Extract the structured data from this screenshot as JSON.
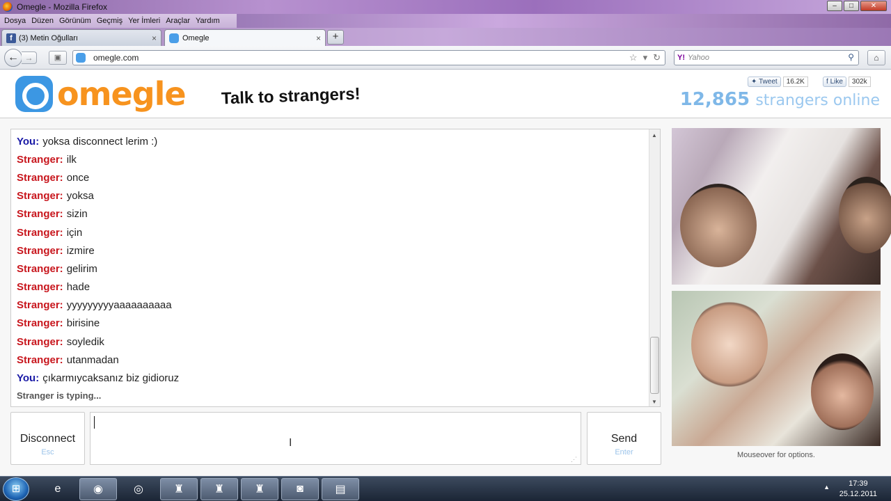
{
  "window": {
    "title": "Omegle - Mozilla Firefox",
    "controls": [
      "–",
      "□",
      "✕"
    ]
  },
  "menu": [
    "Dosya",
    "Düzen",
    "Görünüm",
    "Geçmiş",
    "Yer İmleri",
    "Araçlar",
    "Yardım"
  ],
  "tabs": [
    {
      "label": "(3) Metin Oğulları",
      "close": "×"
    },
    {
      "label": "Omegle",
      "close": "×"
    }
  ],
  "new_tab": "+",
  "nav": {
    "url": "omegle.com",
    "search_placeholder": "Yahoo",
    "search_engine": "Y!"
  },
  "header": {
    "logo_text": "omegle",
    "tagline": "Talk to strangers!",
    "tweet_label": "Tweet",
    "tweet_count": "16.2K",
    "like_label": "Like",
    "like_count": "302k",
    "online_count": "12,865",
    "online_text": "strangers online"
  },
  "chat": {
    "messages": [
      {
        "who": "You:",
        "text": "yoksa disconnect lerim :)",
        "role": "you"
      },
      {
        "who": "Stranger:",
        "text": "ilk",
        "role": "stranger"
      },
      {
        "who": "Stranger:",
        "text": "once",
        "role": "stranger"
      },
      {
        "who": "Stranger:",
        "text": "yoksa",
        "role": "stranger"
      },
      {
        "who": "Stranger:",
        "text": "sizin",
        "role": "stranger"
      },
      {
        "who": "Stranger:",
        "text": "için",
        "role": "stranger"
      },
      {
        "who": "Stranger:",
        "text": "izmire",
        "role": "stranger"
      },
      {
        "who": "Stranger:",
        "text": "gelirim",
        "role": "stranger"
      },
      {
        "who": "Stranger:",
        "text": "hade",
        "role": "stranger"
      },
      {
        "who": "Stranger:",
        "text": "yyyyyyyyyaaaaaaaaaa",
        "role": "stranger"
      },
      {
        "who": "Stranger:",
        "text": "birisine",
        "role": "stranger"
      },
      {
        "who": "Stranger:",
        "text": "soyledik",
        "role": "stranger"
      },
      {
        "who": "Stranger:",
        "text": "utanmadan",
        "role": "stranger"
      },
      {
        "who": "You:",
        "text": "çıkarmıycaksanız biz gidioruz",
        "role": "you"
      }
    ],
    "typing": "Stranger is typing..."
  },
  "controls": {
    "disconnect_label": "Disconnect",
    "disconnect_key": "Esc",
    "send_label": "Send",
    "send_key": "Enter",
    "input_value": ""
  },
  "video": {
    "hint": "Mouseover for options."
  },
  "taskbar": {
    "time": "17:39",
    "date": "25.12.2011",
    "apps": [
      "internet-explorer",
      "firefox",
      "chrome",
      "game-1",
      "game-2",
      "game-3",
      "webcam-app",
      "video-app"
    ]
  },
  "colors": {
    "you": "#1a1aa6",
    "stranger": "#c8161d",
    "brand_orange": "#f7931e",
    "brand_blue": "#3c97e3"
  }
}
